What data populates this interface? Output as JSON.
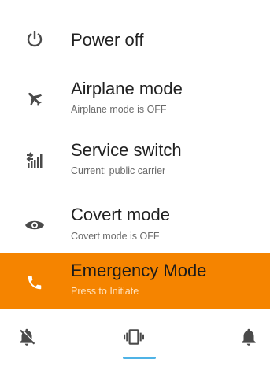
{
  "menu": {
    "items": [
      {
        "title": "Power off",
        "subtitle": ""
      },
      {
        "title": "Airplane mode",
        "subtitle": "Airplane mode is OFF"
      },
      {
        "title": "Service switch",
        "subtitle": "Current: public carrier"
      },
      {
        "title": "Covert mode",
        "subtitle": "Covert mode is OFF"
      },
      {
        "title": "Emergency Mode",
        "subtitle": "Press to Initiate"
      }
    ],
    "icons": [
      "power-icon",
      "airplane-icon",
      "service-switch-icon",
      "eye-icon",
      "phone-icon"
    ]
  },
  "sound_modes": {
    "items": [
      {
        "name": "silent",
        "icon": "bell-off-icon"
      },
      {
        "name": "vibrate",
        "icon": "vibrate-icon",
        "selected": true
      },
      {
        "name": "sound",
        "icon": "bell-icon"
      }
    ]
  },
  "colors": {
    "emergency_background": "#f58400",
    "selected_indicator": "#4fb3e6",
    "icon_gray": "#4a4a4a"
  }
}
